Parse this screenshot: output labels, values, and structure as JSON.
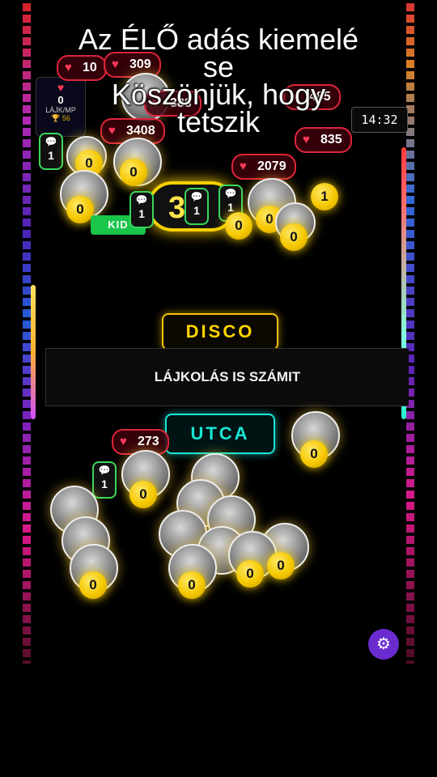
{
  "caption": {
    "line1": "Az ÉLŐ adás kiemelé",
    "line2": "se",
    "line3": "Köszönjük, hogy",
    "line4": "tetszik"
  },
  "stats": {
    "value": "0",
    "label": "LÁJK/MP",
    "sub": "🏆 56"
  },
  "timer": "14:32",
  "center": {
    "value": "3",
    "tag": "KID"
  },
  "hearts": {
    "top_left": "309",
    "top_left2": "10",
    "top_right": "485",
    "top_right2": "835",
    "mid": "2079",
    "mid2": "3408",
    "mid3": "388",
    "lower": "273"
  },
  "zones": {
    "disco": "DISCO",
    "utca": "UTCA"
  },
  "banner": "LÁJKOLÁS IS SZÁMIT",
  "coin_zero": "0",
  "coin_one": "1",
  "chat_count": "1",
  "icons": {
    "heart": "heart-icon",
    "chat": "chat-bubble-icon",
    "gear": "gear-icon"
  },
  "colors": {
    "disco": "#f5c400",
    "utca": "#19e6d6",
    "coin": "#f5c800",
    "heart": "#e0243a",
    "settings": "#6a2ccf"
  }
}
